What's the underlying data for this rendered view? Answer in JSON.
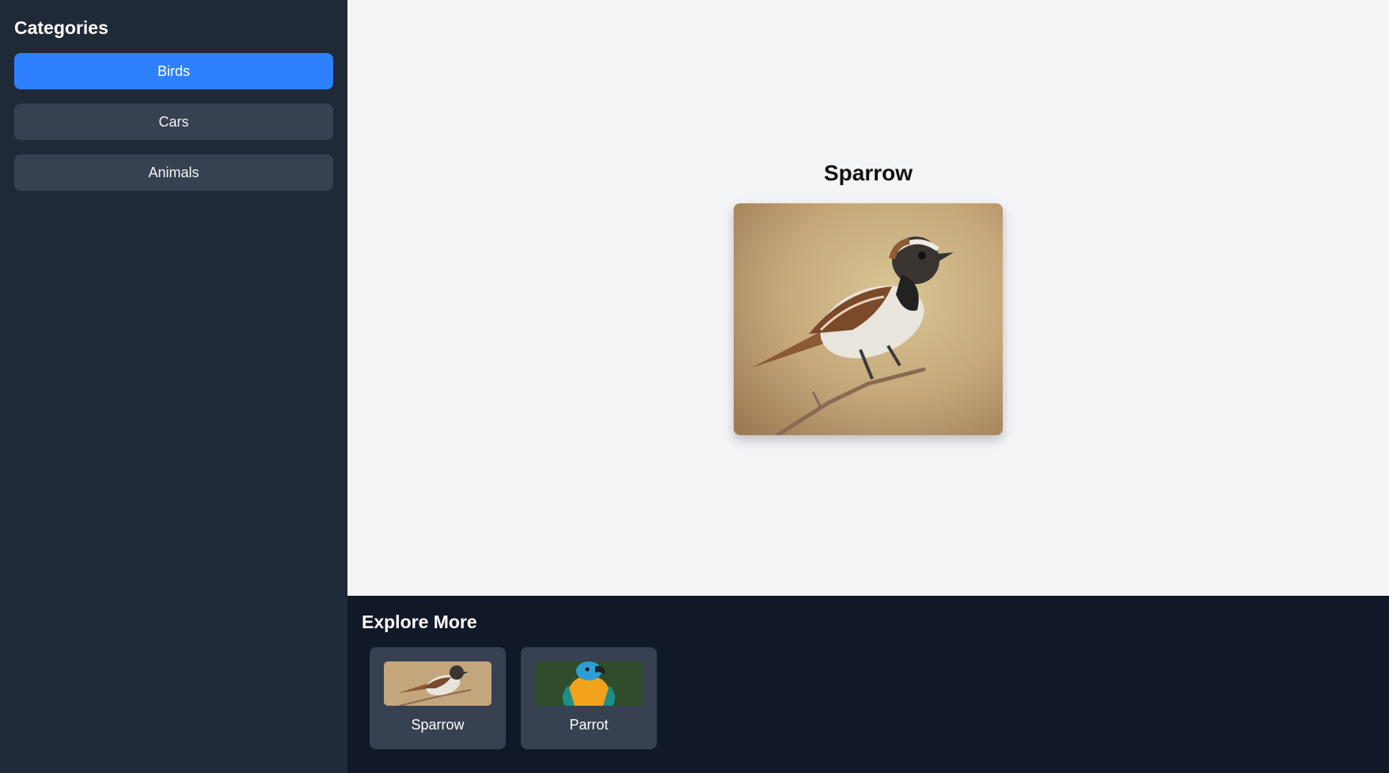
{
  "sidebar": {
    "title": "Categories",
    "items": [
      {
        "label": "Birds",
        "active": true
      },
      {
        "label": "Cars",
        "active": false
      },
      {
        "label": "Animals",
        "active": false
      }
    ]
  },
  "viewer": {
    "title": "Sparrow",
    "image_icon": "sparrow-photo"
  },
  "explore": {
    "title": "Explore More",
    "items": [
      {
        "label": "Sparrow",
        "image_icon": "sparrow-thumbnail"
      },
      {
        "label": "Parrot",
        "image_icon": "parrot-thumbnail"
      }
    ]
  },
  "colors": {
    "sidebar_bg": "#1f2937",
    "active_button": "#2f80fd",
    "button_bg": "#374151",
    "viewer_bg": "#f3f4f6",
    "explore_bg": "#111827"
  }
}
